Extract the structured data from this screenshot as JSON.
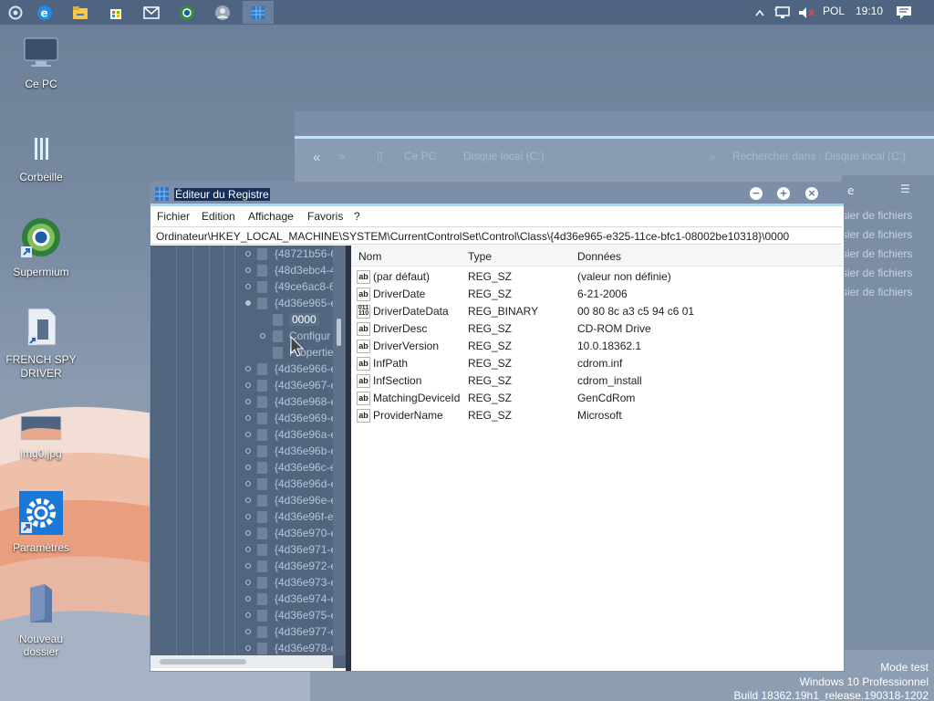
{
  "taskbar": {
    "tray": {
      "language": "POL",
      "time": "19:10"
    }
  },
  "desktop": {
    "icons": [
      {
        "label": "Ce PC"
      },
      {
        "label": "Corbeille"
      },
      {
        "label": "Supermium"
      },
      {
        "label": "FRENCH SPY DRIVER"
      },
      {
        "label": "img0.jpg"
      },
      {
        "label": "Paramètres"
      },
      {
        "label": "Nouveau dossier"
      }
    ],
    "watermark": {
      "line1": "Mode test",
      "line2": "Windows 10 Professionnel",
      "line3": "Build 18362.19h1_release.190318-1202"
    }
  },
  "explorer": {
    "breadcrumb_1": "Ce PC",
    "breadcrumb_2": "Disque local (C:)",
    "search_placeholder": "Rechercher dans : Disque local (C:)",
    "side_letter": "e",
    "rows": [
      "sier de fichiers",
      "sier de fichiers",
      "sier de fichiers",
      "sier de fichiers",
      "sier de fichiers"
    ]
  },
  "regedit": {
    "title": "Éditeur du Registre",
    "menu": [
      "Fichier",
      "Edition",
      "Affichage",
      "Favoris",
      "?"
    ],
    "address": "Ordinateur\\HKEY_LOCAL_MACHINE\\SYSTEM\\CurrentControlSet\\Control\\Class\\{4d36e965-e325-11ce-bfc1-08002be10318}\\0000",
    "tree": [
      "{48721b56-6",
      "{48d3ebc4-4",
      "{49ce6ac8-6",
      "{4d36e965-e",
      "0000",
      "Configur",
      "Propertie",
      "{4d36e966-e",
      "{4d36e967-e",
      "{4d36e968-e",
      "{4d36e969-e",
      "{4d36e96a-e",
      "{4d36e96b-e",
      "{4d36e96c-e",
      "{4d36e96d-e",
      "{4d36e96e-e",
      "{4d36e96f-e",
      "{4d36e970-e",
      "{4d36e971-e",
      "{4d36e972-e",
      "{4d36e973-e",
      "{4d36e974-e",
      "{4d36e975-e",
      "{4d36e977-e",
      "{4d36e978-e"
    ],
    "columns": {
      "name": "Nom",
      "type": "Type",
      "data": "Données"
    },
    "values": [
      {
        "name": "(par défaut)",
        "type": "REG_SZ",
        "data": "(valeur non définie)",
        "icon": "ab"
      },
      {
        "name": "DriverDate",
        "type": "REG_SZ",
        "data": "6-21-2006",
        "icon": "ab"
      },
      {
        "name": "DriverDateData",
        "type": "REG_BINARY",
        "data": "00 80 8c a3 c5 94 c6 01",
        "icon": "bin"
      },
      {
        "name": "DriverDesc",
        "type": "REG_SZ",
        "data": "CD-ROM Drive",
        "icon": "ab"
      },
      {
        "name": "DriverVersion",
        "type": "REG_SZ",
        "data": "10.0.18362.1",
        "icon": "ab"
      },
      {
        "name": "InfPath",
        "type": "REG_SZ",
        "data": "cdrom.inf",
        "icon": "ab"
      },
      {
        "name": "InfSection",
        "type": "REG_SZ",
        "data": "cdrom_install",
        "icon": "ab"
      },
      {
        "name": "MatchingDeviceId",
        "type": "REG_SZ",
        "data": "GenCdRom",
        "icon": "ab"
      },
      {
        "name": "ProviderName",
        "type": "REG_SZ",
        "data": "Microsoft",
        "icon": "ab"
      }
    ]
  }
}
